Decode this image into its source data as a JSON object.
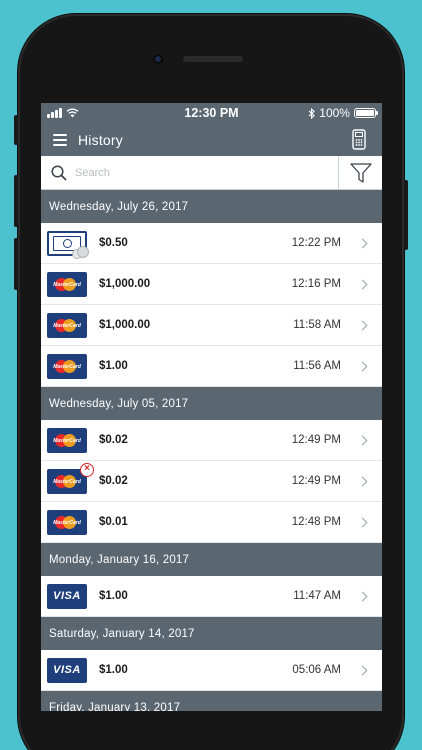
{
  "status_bar": {
    "time": "12:30 PM",
    "battery": "100%"
  },
  "nav": {
    "title": "History"
  },
  "search": {
    "placeholder": "Search"
  },
  "sections": [
    {
      "date": "Wednesday, July 26, 2017",
      "rows": [
        {
          "card": "cash",
          "amount": "$0.50",
          "time": "12:22 PM",
          "voided": false
        },
        {
          "card": "mastercard",
          "amount": "$1,000.00",
          "time": "12:16 PM",
          "voided": false
        },
        {
          "card": "mastercard",
          "amount": "$1,000.00",
          "time": "11:58 AM",
          "voided": false
        },
        {
          "card": "mastercard",
          "amount": "$1.00",
          "time": "11:56 AM",
          "voided": false
        }
      ]
    },
    {
      "date": "Wednesday, July 05, 2017",
      "rows": [
        {
          "card": "mastercard",
          "amount": "$0.02",
          "time": "12:49 PM",
          "voided": false
        },
        {
          "card": "mastercard",
          "amount": "$0.02",
          "time": "12:49 PM",
          "voided": true
        },
        {
          "card": "mastercard",
          "amount": "$0.01",
          "time": "12:48 PM",
          "voided": false
        }
      ]
    },
    {
      "date": "Monday, January 16, 2017",
      "rows": [
        {
          "card": "visa",
          "amount": "$1.00",
          "time": "11:47 AM",
          "voided": false
        }
      ]
    },
    {
      "date": "Saturday, January 14, 2017",
      "rows": [
        {
          "card": "visa",
          "amount": "$1.00",
          "time": "05:06 AM",
          "voided": false
        }
      ]
    },
    {
      "date": "Friday, January 13, 2017",
      "rows": []
    }
  ],
  "card_labels": {
    "mastercard": "MasterCard",
    "visa": "VISA"
  },
  "colors": {
    "header": "#5a6670",
    "card_blue": "#1e3f7c",
    "background": "#4cc2cf",
    "void_red": "#d9282a"
  }
}
